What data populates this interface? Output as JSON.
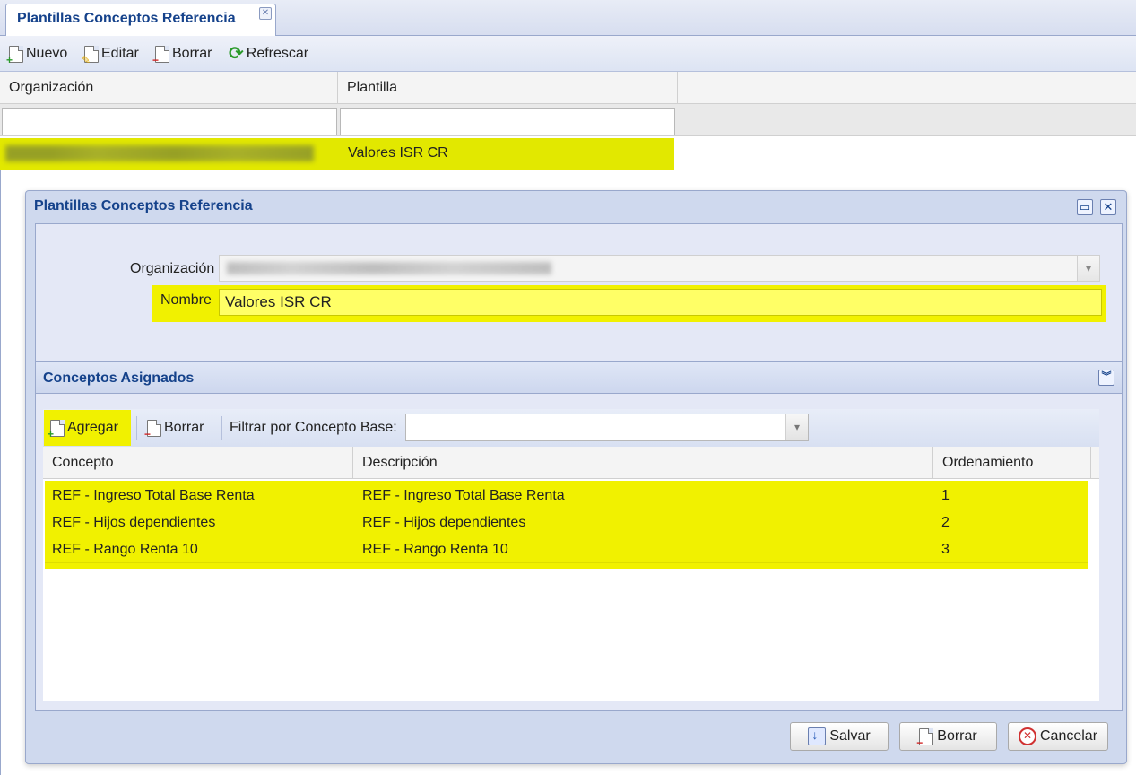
{
  "tab": {
    "title": "Plantillas Conceptos Referencia",
    "close_glyph": "✕"
  },
  "toolbar": {
    "nuevo": "Nuevo",
    "editar": "Editar",
    "borrar": "Borrar",
    "refrescar": "Refrescar"
  },
  "grid": {
    "columns": [
      "Organización",
      "Plantilla"
    ],
    "rows": [
      {
        "organizacion": "",
        "plantilla": "Valores ISR CR",
        "selected": true
      }
    ]
  },
  "dialog": {
    "title": "Plantillas Conceptos Referencia",
    "form": {
      "organizacion_label": "Organización",
      "organizacion_value": "",
      "nombre_label": "Nombre",
      "nombre_value": "Valores ISR CR"
    },
    "conceptos": {
      "title": "Conceptos Asignados",
      "agregar": "Agregar",
      "borrar": "Borrar",
      "filtrar_label": "Filtrar por Concepto Base:",
      "filtrar_value": "",
      "columns": [
        "Concepto",
        "Descripción",
        "Ordenamiento"
      ],
      "rows": [
        {
          "concepto": "REF - Ingreso Total Base Renta",
          "descripcion": "REF - Ingreso Total Base Renta",
          "orden": "1"
        },
        {
          "concepto": "REF - Hijos dependientes",
          "descripcion": "REF - Hijos dependientes",
          "orden": "2"
        },
        {
          "concepto": "REF - Rango Renta 10",
          "descripcion": "REF - Rango Renta 10",
          "orden": "3"
        }
      ]
    },
    "buttons": {
      "salvar": "Salvar",
      "borrar": "Borrar",
      "cancelar": "Cancelar"
    }
  },
  "icons": {
    "nuevo": "document-add-icon",
    "editar": "document-edit-icon",
    "borrar": "document-delete-icon",
    "refrescar": "refresh-icon",
    "salvar": "save-icon",
    "cancelar": "cancel-icon"
  },
  "colors": {
    "highlight": "#f1f100",
    "title_blue": "#15428b",
    "panel_bg": "#cfd9ee"
  }
}
